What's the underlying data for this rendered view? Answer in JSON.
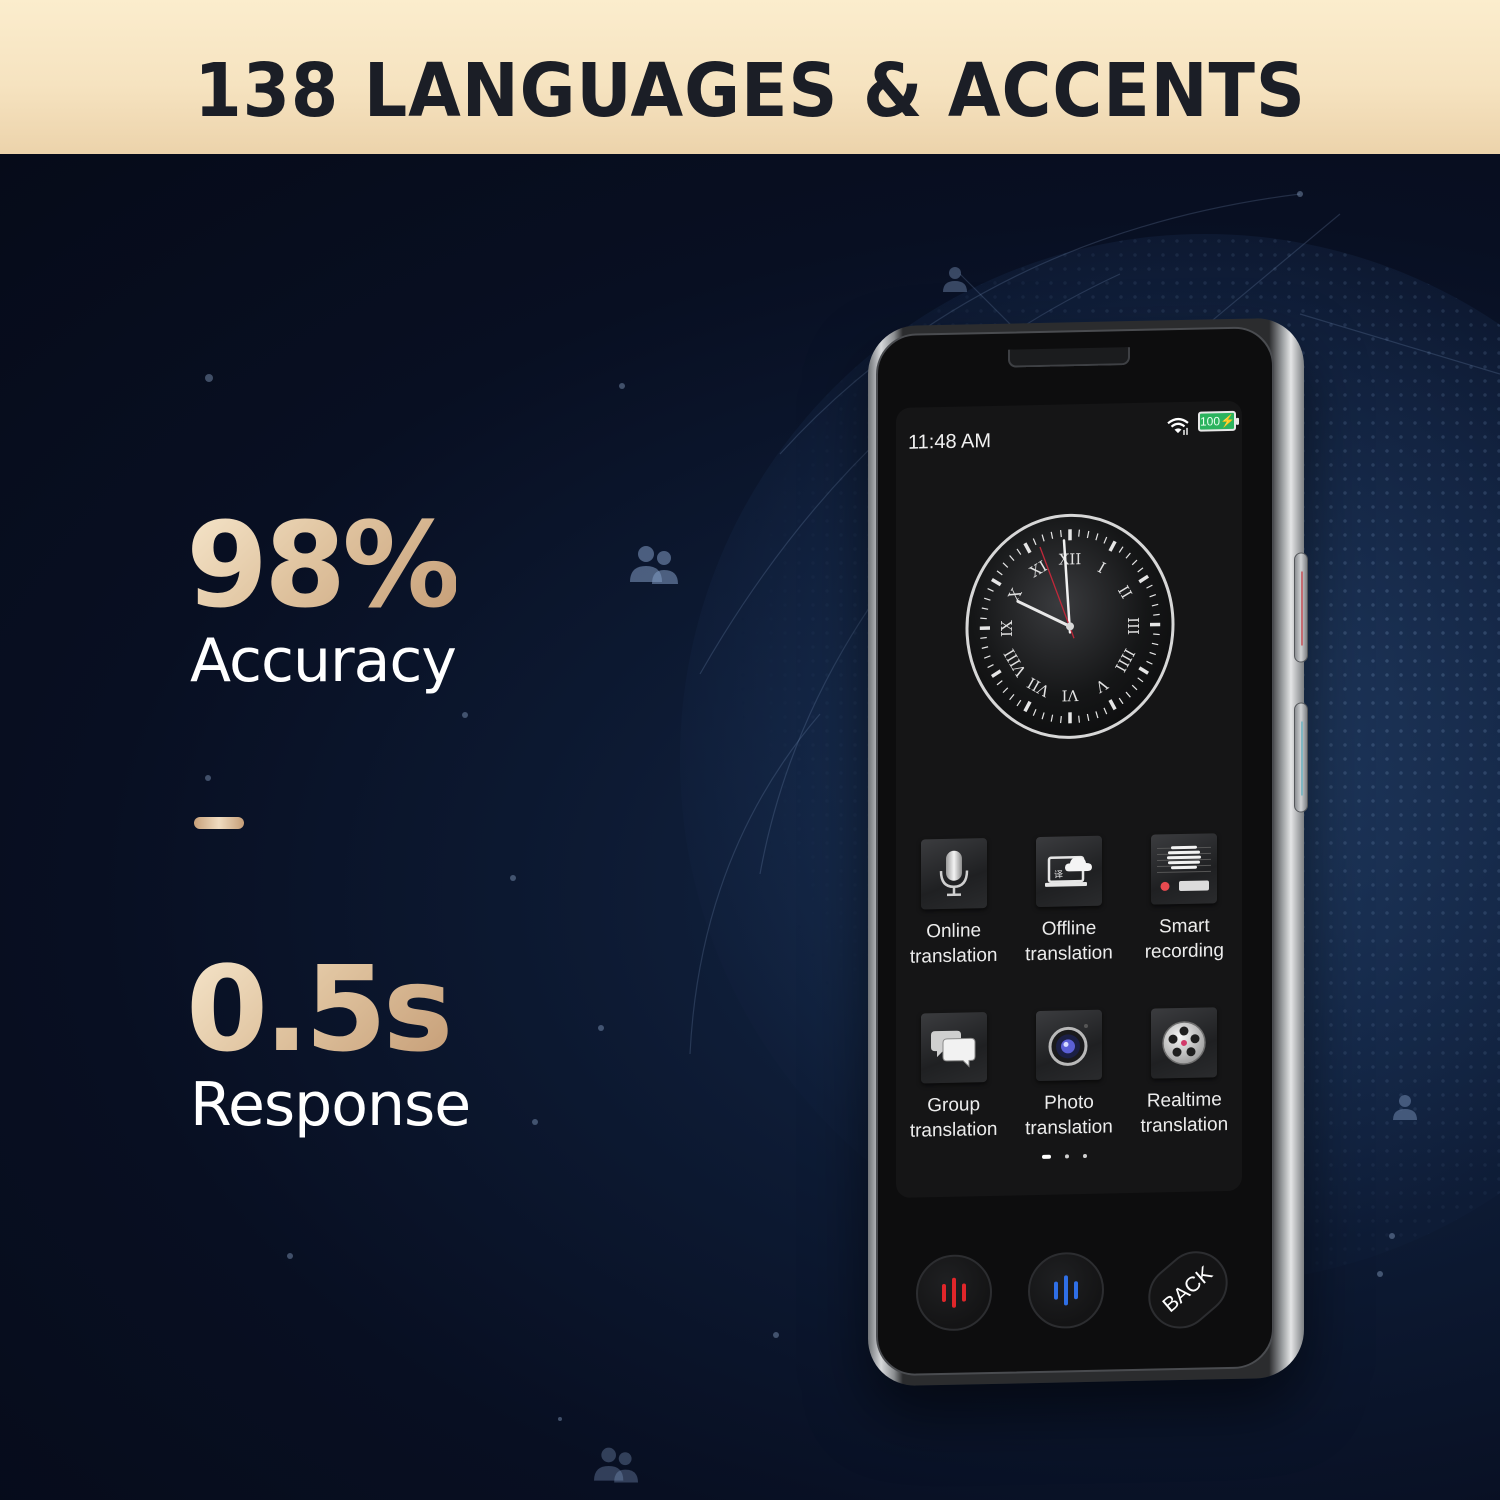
{
  "banner": {
    "title": "138 LANGUAGES & ACCENTS"
  },
  "stats": [
    {
      "value": "98%",
      "label": "Accuracy"
    },
    {
      "value": "0.5s",
      "label": "Response"
    }
  ],
  "device": {
    "status_bar": {
      "time": "11:48 AM",
      "wifi_icon": "wifi-icon",
      "battery_level": "100",
      "battery_charging": true,
      "battery_color": "#2bb35e"
    },
    "clock_widget": {
      "style": "analog-roman",
      "numerals": [
        "XII",
        "I",
        "II",
        "III",
        "IIII",
        "V",
        "VI",
        "VII",
        "VIII",
        "IX",
        "X",
        "XI"
      ],
      "time": "11:48",
      "second_hand_color": "#c0283a"
    },
    "apps": [
      {
        "label_line1": "Online",
        "label_line2": "translation",
        "icon": "microphone-icon"
      },
      {
        "label_line1": "Offline",
        "label_line2": "translation",
        "icon": "laptop-cloud-icon"
      },
      {
        "label_line1": "Smart",
        "label_line2": "recording",
        "icon": "recorder-icon"
      },
      {
        "label_line1": "Group",
        "label_line2": "translation",
        "icon": "chat-bubbles-icon"
      },
      {
        "label_line1": "Photo",
        "label_line2": "translation",
        "icon": "camera-icon"
      },
      {
        "label_line1": "Realtime",
        "label_line2": "translation",
        "icon": "reel-icon"
      }
    ],
    "page_indicator": {
      "pages": 3,
      "current": 1
    },
    "hardware_buttons": {
      "left_voice": {
        "icon": "voice-wave-icon",
        "color": "#e0262a"
      },
      "right_voice": {
        "icon": "voice-wave-icon",
        "color": "#2f6fe6"
      },
      "back_label": "BACK"
    },
    "side_keys": [
      {
        "accent": "#c46a70"
      },
      {
        "accent": "#7fb6c2"
      }
    ]
  },
  "colors": {
    "banner_text": "#1b1e26",
    "gold_start": "#f7e8ce",
    "gold_end": "#c49b74",
    "background": "#070d1c"
  }
}
